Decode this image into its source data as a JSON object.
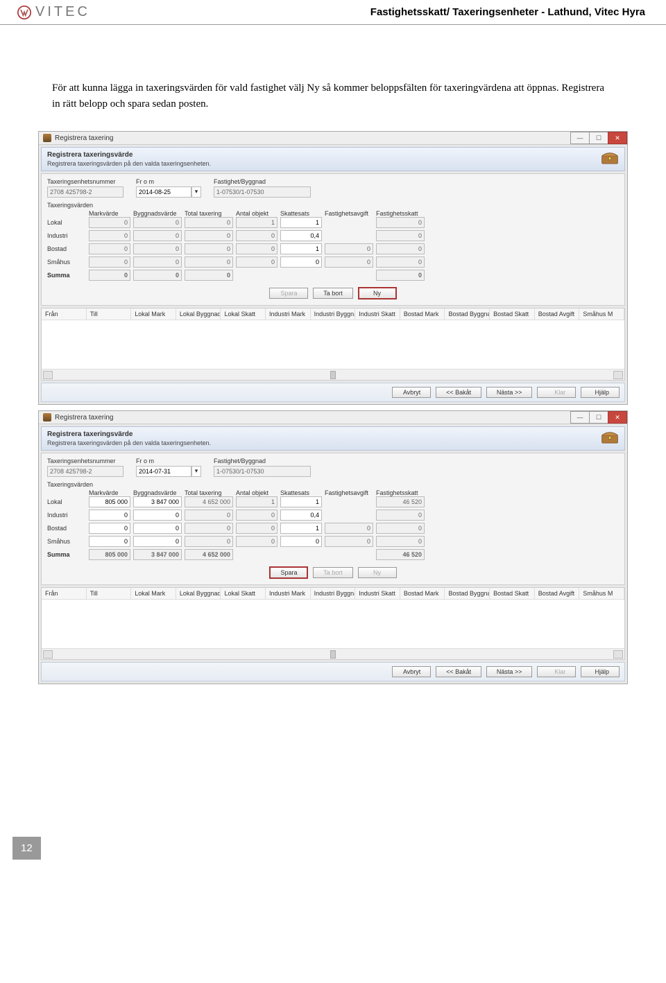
{
  "header": {
    "logo_text": "VITEC",
    "title": "Fastighetsskatt/ Taxeringsenheter - Lathund, Vitec Hyra"
  },
  "intro_text": "För att kunna lägga in taxeringsvärden för vald fastighet välj Ny så kommer beloppsfälten för taxeringvärdena att öppnas. Registrera in rätt belopp och spara sedan posten.",
  "window": {
    "title": "Registrera taxering",
    "panel_title": "Registrera taxeringsvärde",
    "panel_sub": "Registrera taxeringsvärden på den valda taxeringsenheten."
  },
  "labels": {
    "tax_no": "Taxeringsenhetsnummer",
    "from": "Fr o m",
    "fast": "Fastighet/Byggnad",
    "subgroup": "Taxeringsvärden",
    "col_mark": "Markvärde",
    "col_bygg": "Byggnadsvärde",
    "col_total": "Total taxering",
    "col_antal": "Antal objekt",
    "col_sats": "Skattesats",
    "col_avgift": "Fastighetsavgift",
    "col_skatt": "Fastighetsskatt"
  },
  "row_labels": [
    "Lokal",
    "Industri",
    "Bostad",
    "Småhus",
    "Summa"
  ],
  "sc1": {
    "tax_no": "2708 425798-2",
    "from": "2014-08-25",
    "fast": "1-07530/1-07530",
    "rows": [
      {
        "m": "0",
        "b": "0",
        "t": "0",
        "a": "1",
        "s": "1",
        "av": "",
        "sk": "0"
      },
      {
        "m": "0",
        "b": "0",
        "t": "0",
        "a": "0",
        "s": "0,4",
        "av": "",
        "sk": "0"
      },
      {
        "m": "0",
        "b": "0",
        "t": "0",
        "a": "0",
        "s": "1",
        "av": "0",
        "sk": "0"
      },
      {
        "m": "0",
        "b": "0",
        "t": "0",
        "a": "0",
        "s": "0",
        "av": "0",
        "sk": "0"
      },
      {
        "m": "0",
        "b": "0",
        "t": "0",
        "a": "",
        "s": "",
        "av": "",
        "sk": "0"
      }
    ]
  },
  "sc2": {
    "tax_no": "2708 425798-2",
    "from": "2014-07-31",
    "fast": "1-07530/1-07530",
    "rows": [
      {
        "m": "805 000",
        "b": "3 847 000",
        "t": "4 652 000",
        "a": "1",
        "s": "1",
        "av": "",
        "sk": "46 520"
      },
      {
        "m": "0",
        "b": "0",
        "t": "0",
        "a": "0",
        "s": "0,4",
        "av": "",
        "sk": "0"
      },
      {
        "m": "0",
        "b": "0",
        "t": "0",
        "a": "0",
        "s": "1",
        "av": "0",
        "sk": "0"
      },
      {
        "m": "0",
        "b": "0",
        "t": "0",
        "a": "0",
        "s": "0",
        "av": "0",
        "sk": "0"
      },
      {
        "m": "805 000",
        "b": "3 847 000",
        "t": "4 652 000",
        "a": "",
        "s": "",
        "av": "",
        "sk": "46 520"
      }
    ]
  },
  "buttons": {
    "spara": "Spara",
    "tabort": "Ta bort",
    "ny": "Ny",
    "avbryt": "Avbryt",
    "bakåt": "<< Bakåt",
    "nasta": "Nästa >>",
    "klar": "Klar",
    "hjalp": "Hjälp"
  },
  "table_cols": [
    "Från",
    "Till",
    "Lokal Mark",
    "Lokal Byggnad",
    "Lokal Skatt",
    "Industri Mark",
    "Industri Byggnad",
    "Industri Skatt",
    "Bostad Mark",
    "Bostad Byggnad",
    "Bostad Skatt",
    "Bostad Avgift",
    "Småhus M"
  ],
  "page_number": "12"
}
